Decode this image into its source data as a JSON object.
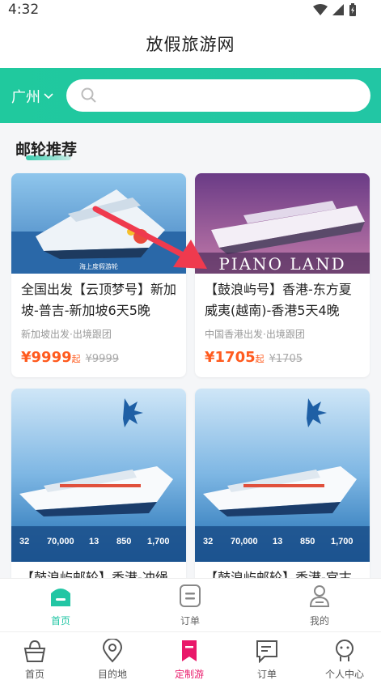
{
  "status": {
    "time": "4:32"
  },
  "header": {
    "title": "放假旅游网"
  },
  "search": {
    "city": "广州",
    "placeholder": ""
  },
  "section": {
    "title": "邮轮推荐"
  },
  "cards": [
    {
      "name": "全国出发【云顶梦号】新加坡-普吉-新加坡6天5晚",
      "sub": "新加坡出发·出境跟团",
      "price": "¥9999",
      "unit": "起",
      "orig": "¥9999",
      "img_text": "海上度假游轮"
    },
    {
      "name": "【鼓浪屿号】香港-东方夏威夷(越南)-香港5天4晚",
      "sub": "中国香港出发·出境跟团",
      "price": "¥1705",
      "unit": "起",
      "orig": "¥1705",
      "img_text": "PIANO LAND"
    },
    {
      "name": "【鼓浪屿邮轮】香港-冲绳",
      "img_stats": [
        "32",
        "70,000",
        "13",
        "850",
        "1,700"
      ]
    },
    {
      "name": "【鼓浪屿邮轮】香港-宫古",
      "img_stats": [
        "32",
        "70,000",
        "13",
        "850",
        "1,700"
      ]
    }
  ],
  "tabbar1": [
    {
      "label": "首页",
      "icon": "home-icon"
    },
    {
      "label": "订单",
      "icon": "order-icon"
    },
    {
      "label": "我的",
      "icon": "user-icon"
    }
  ],
  "tabbar2": [
    {
      "label": "首页",
      "icon": "bag-icon"
    },
    {
      "label": "目的地",
      "icon": "location-icon"
    },
    {
      "label": "定制游",
      "icon": "bookmark-icon"
    },
    {
      "label": "订单",
      "icon": "list-icon"
    },
    {
      "label": "个人中心",
      "icon": "person-icon"
    }
  ],
  "colors": {
    "accent": "#22c6a4",
    "price": "#ff5b1f",
    "active_tab2": "#e9186a"
  }
}
